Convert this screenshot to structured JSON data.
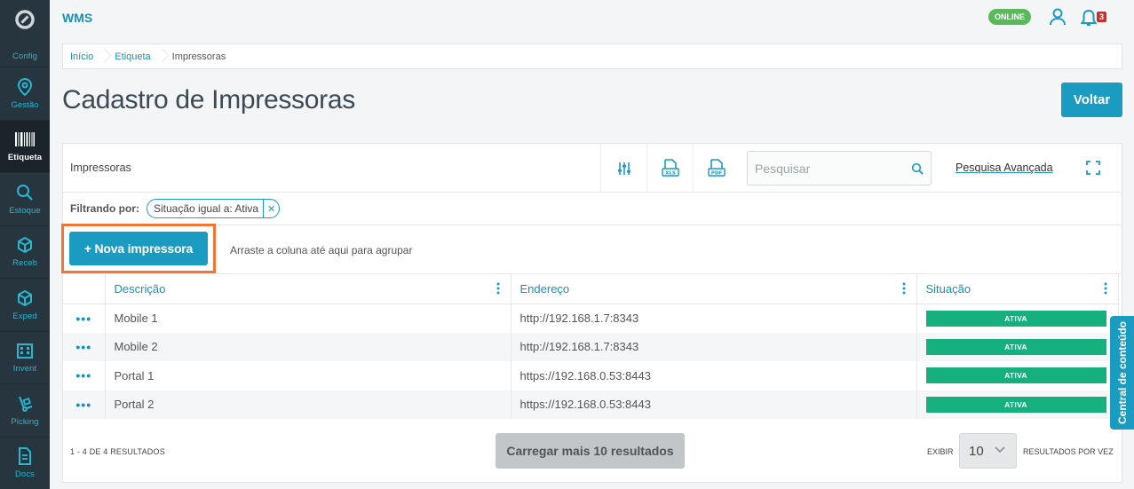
{
  "app": {
    "title": "WMS",
    "status": "ONLINE",
    "notifications": "3"
  },
  "sidebar": {
    "items": [
      {
        "label": "Config",
        "icon": "gear-icon"
      },
      {
        "label": "Gestão",
        "icon": "map-pin-icon"
      },
      {
        "label": "Etiqueta",
        "icon": "barcode-icon",
        "active": true
      },
      {
        "label": "Estoque",
        "icon": "search-icon"
      },
      {
        "label": "Receb",
        "icon": "box-icon"
      },
      {
        "label": "Exped",
        "icon": "box-icon"
      },
      {
        "label": "Invent",
        "icon": "building-icon"
      },
      {
        "label": "Picking",
        "icon": "hand-truck-icon"
      },
      {
        "label": "Docs",
        "icon": "document-icon"
      }
    ]
  },
  "breadcrumb": [
    "Início",
    "Etiqueta",
    "Impressoras"
  ],
  "page": {
    "title": "Cadastro de Impressoras",
    "back_label": "Voltar"
  },
  "panel": {
    "title": "Impressoras",
    "search_placeholder": "Pesquisar",
    "advanced_search": "Pesquisa Avançada",
    "filter_label": "Filtrando por:",
    "filter_chip": "Situação igual a: Ativa",
    "new_button": "+ Nova impressora",
    "group_hint": "Arraste a coluna até aqui para agrupar"
  },
  "table": {
    "columns": [
      "Descrição",
      "Endereço",
      "Situação"
    ],
    "rows": [
      {
        "descricao": "Mobile 1",
        "endereco": "http://192.168.1.7:8343",
        "situacao": "ATIVA"
      },
      {
        "descricao": "Mobile 2",
        "endereco": "http://192.168.1.7:8343",
        "situacao": "ATIVA"
      },
      {
        "descricao": "Portal 1",
        "endereco": "https://192.168.0.53:8443",
        "situacao": "ATIVA"
      },
      {
        "descricao": "Portal 2",
        "endereco": "https://192.168.0.53:8443",
        "situacao": "ATIVA"
      }
    ],
    "row_actions": "•••"
  },
  "footer": {
    "count": "1 - 4 DE 4 RESULTADOS",
    "load_more": "Carregar mais 10 resultados",
    "exibir": "EXIBIR",
    "per_page": "10",
    "per_page_suffix": "RESULTADOS POR VEZ"
  },
  "side_tab": "Central de conteúdo",
  "colors": {
    "accent": "#1a9cc2",
    "sidebar": "#27353f",
    "highlight": "#f37435",
    "active_badge": "#16b07f",
    "online": "#5cb85c"
  }
}
